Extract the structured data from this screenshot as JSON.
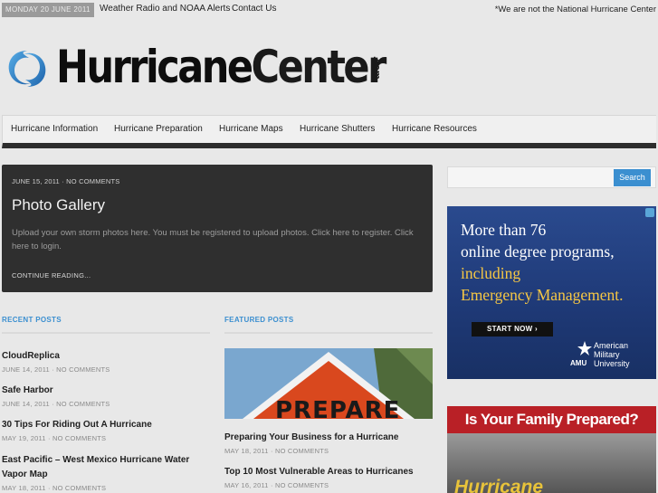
{
  "topbar": {
    "date": "MONDAY 20 JUNE 2011",
    "links": [
      "Weather Radio and NOAA Alerts",
      "Contact Us"
    ],
    "disclaimer": "*We are not the National Hurricane Center"
  },
  "logo": {
    "word1": "Hurricane",
    "word2": "Center",
    "suffix": ".com"
  },
  "nav": {
    "items": [
      "Hurricane Information",
      "Hurricane Preparation",
      "Hurricane Maps",
      "Hurricane Shutters",
      "Hurricane Resources"
    ]
  },
  "feature": {
    "meta": "JUNE 15, 2011 · NO COMMENTS",
    "title": "Photo Gallery",
    "excerpt": "Upload your own storm photos here. You must be registered to upload photos. Click here to register. Click here to login.",
    "more": "CONTINUE READING..."
  },
  "recent": {
    "heading": "RECENT POSTS",
    "posts": [
      {
        "title": "CloudReplica",
        "meta": "JUNE 14, 2011 · NO COMMENTS"
      },
      {
        "title": "Safe Harbor",
        "meta": "JUNE 14, 2011 · NO COMMENTS"
      },
      {
        "title": "30 Tips For Riding Out A Hurricane",
        "meta": "MAY 19, 2011 · NO COMMENTS"
      },
      {
        "title": "East Pacific – West Mexico Hurricane Water Vapor Map",
        "meta": "MAY 18, 2011 · NO COMMENTS"
      }
    ]
  },
  "featured": {
    "heading": "FEATURED POSTS",
    "image_text": "PREPARE",
    "posts": [
      {
        "title": "Preparing Your Business for a Hurricane",
        "meta": "MAY 18, 2011 · NO COMMENTS"
      },
      {
        "title": "Top 10 Most Vulnerable Areas to Hurricanes",
        "meta": "MAY 16, 2011 · NO COMMENTS"
      }
    ]
  },
  "sidebar": {
    "search_placeholder": "",
    "search_button": "Search",
    "ad1": {
      "lines": [
        "More than 76",
        "online degree programs,",
        "including",
        "Emergency Management."
      ],
      "button": "START NOW ›",
      "org_lines": [
        "American",
        "Military",
        "University"
      ],
      "org_abbr": "AMU"
    },
    "ad2": {
      "headline": "Is Your Family Prepared?",
      "sub": "Hurricane"
    }
  },
  "colors": {
    "accent": "#3b8fd0",
    "feature_bg": "#2f2f2f",
    "page_bg": "#e8e8e8",
    "nav_border": "#2d2d2d"
  }
}
